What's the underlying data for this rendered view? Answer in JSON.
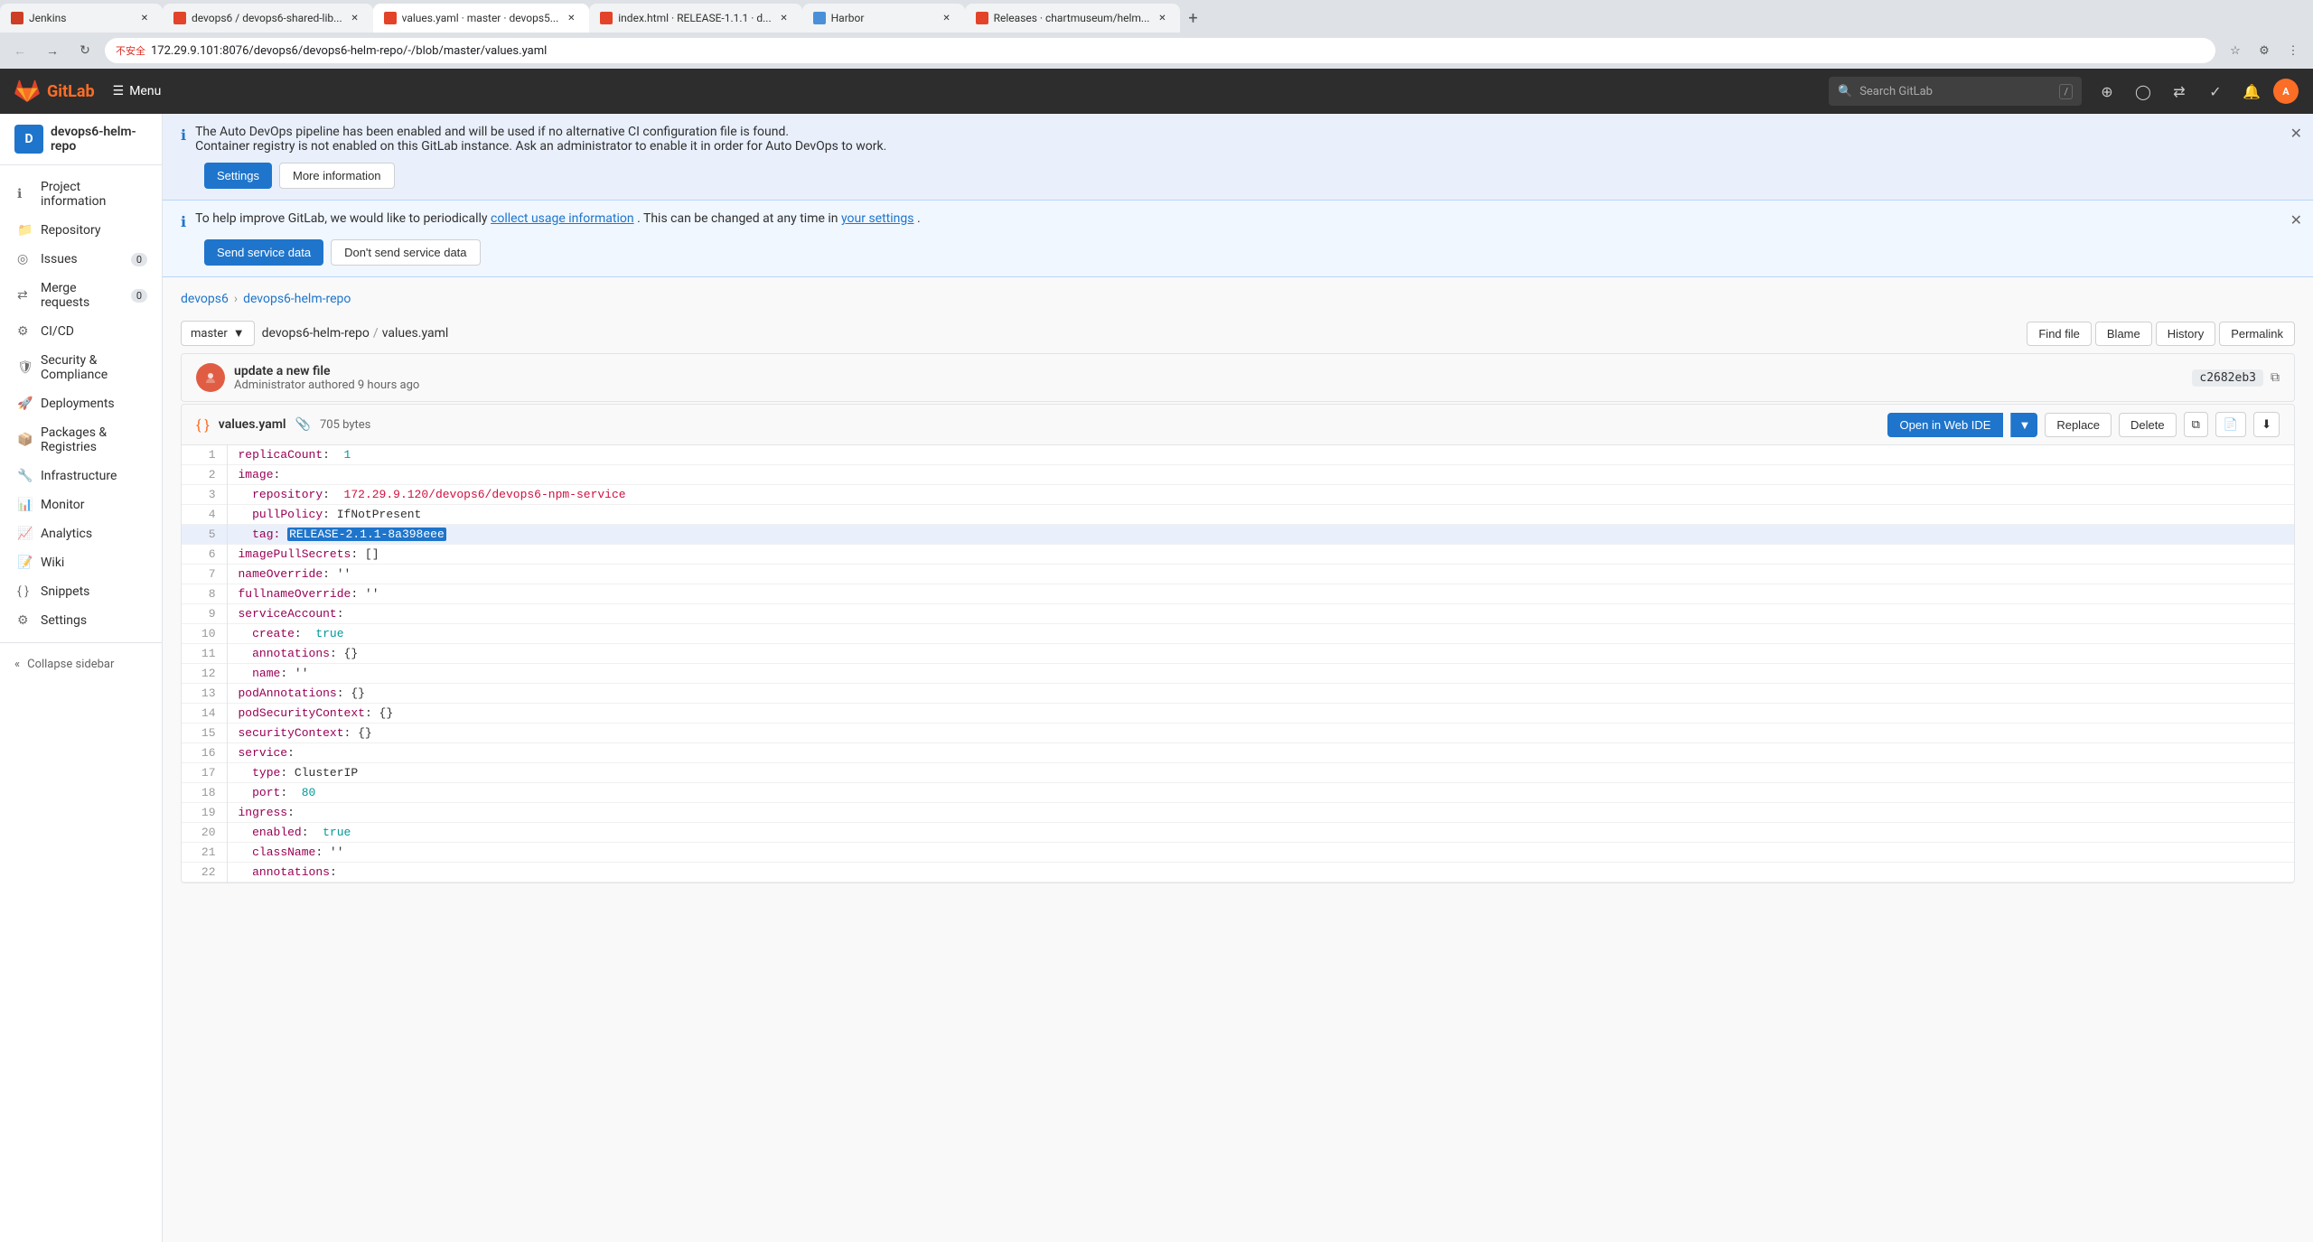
{
  "browser": {
    "tabs": [
      {
        "id": "jenkins",
        "title": "Jenkins",
        "favicon_color": "#cc3e26",
        "active": false
      },
      {
        "id": "devops6",
        "title": "devops6 / devops6-shared-lib...",
        "favicon_color": "#e24329",
        "active": false
      },
      {
        "id": "values-yaml",
        "title": "values.yaml · master · devops5...",
        "favicon_color": "#e24329",
        "active": true
      },
      {
        "id": "index-html",
        "title": "index.html · RELEASE-1.1.1 · d...",
        "favicon_color": "#e24329",
        "active": false
      },
      {
        "id": "harbor",
        "title": "Harbor",
        "favicon_color": "#4a90d9",
        "active": false
      },
      {
        "id": "releases",
        "title": "Releases · chartmuseum/helm...",
        "favicon_color": "#e24329",
        "active": false
      }
    ],
    "url": "172.29.9.101:8076/devops6/devops6-helm-repo/-/blob/master/values.yaml",
    "url_secure_label": "不安全"
  },
  "header": {
    "logo": "GitLab",
    "menu_label": "Menu",
    "search_placeholder": "Search GitLab",
    "search_shortcut": "/"
  },
  "sidebar": {
    "project_name": "devops6-helm-repo",
    "project_initial": "D",
    "items": [
      {
        "id": "project-information",
        "label": "Project information",
        "icon": "info"
      },
      {
        "id": "repository",
        "label": "Repository",
        "icon": "folder"
      },
      {
        "id": "issues",
        "label": "Issues",
        "icon": "issue",
        "badge": "0"
      },
      {
        "id": "merge-requests",
        "label": "Merge requests",
        "icon": "merge",
        "badge": "0"
      },
      {
        "id": "cicd",
        "label": "CI/CD",
        "icon": "cicd"
      },
      {
        "id": "security-compliance",
        "label": "Security & Compliance",
        "icon": "shield"
      },
      {
        "id": "deployments",
        "label": "Deployments",
        "icon": "deploy"
      },
      {
        "id": "packages-registries",
        "label": "Packages & Registries",
        "icon": "package"
      },
      {
        "id": "infrastructure",
        "label": "Infrastructure",
        "icon": "infra"
      },
      {
        "id": "monitor",
        "label": "Monitor",
        "icon": "monitor"
      },
      {
        "id": "analytics",
        "label": "Analytics",
        "icon": "chart"
      },
      {
        "id": "wiki",
        "label": "Wiki",
        "icon": "wiki"
      },
      {
        "id": "snippets",
        "label": "Snippets",
        "icon": "snippet"
      },
      {
        "id": "settings",
        "label": "Settings",
        "icon": "gear"
      }
    ],
    "collapse_label": "Collapse sidebar"
  },
  "banners": {
    "autodevops": {
      "text1": "The Auto DevOps pipeline has been enabled and will be used if no alternative CI configuration file is found.",
      "text2": "Container registry is not enabled on this GitLab instance. Ask an administrator to enable it in order for Auto DevOps to work.",
      "btn_settings": "Settings",
      "btn_more": "More information"
    },
    "usage": {
      "text_prefix": "To help improve GitLab, we would like to periodically",
      "link_text": "collect usage information",
      "text_middle": ". This can be changed at any time in",
      "link_settings": "your settings",
      "text_suffix": ".",
      "btn_send": "Send service data",
      "btn_dont_send": "Don't send service data"
    }
  },
  "breadcrumb": {
    "items": [
      "devops6",
      "devops6-helm-repo"
    ]
  },
  "file_toolbar": {
    "branch": "master",
    "repo": "devops6-helm-repo",
    "separator": "/",
    "filename": "values.yaml",
    "btn_find": "Find file",
    "btn_blame": "Blame",
    "btn_history": "History",
    "btn_permalink": "Permalink"
  },
  "commit": {
    "message": "update a new file",
    "author": "Administrator",
    "authored": "authored 9 hours ago",
    "hash": "c2682eb3"
  },
  "file": {
    "icon": "{}",
    "name": "values.yaml",
    "copy_icon": "📎",
    "size": "705 bytes",
    "btn_open_ide": "Open in Web IDE",
    "btn_replace": "Replace",
    "btn_delete": "Delete"
  },
  "code": {
    "lines": [
      {
        "num": 1,
        "content": "replicaCount: 1",
        "type": "normal"
      },
      {
        "num": 2,
        "content": "image:",
        "type": "normal"
      },
      {
        "num": 3,
        "content": "  repository: 172.29.9.120/devops6/devops6-npm-service",
        "type": "normal"
      },
      {
        "num": 4,
        "content": "  pullPolicy: IfNotPresent",
        "type": "normal"
      },
      {
        "num": 5,
        "content": "  tag: RELEASE-2.1.1-8a398eee",
        "type": "highlight"
      },
      {
        "num": 6,
        "content": "imagePullSecrets: []",
        "type": "normal"
      },
      {
        "num": 7,
        "content": "nameOverride: ''",
        "type": "normal"
      },
      {
        "num": 8,
        "content": "fullnameOverride: ''",
        "type": "normal"
      },
      {
        "num": 9,
        "content": "serviceAccount:",
        "type": "normal"
      },
      {
        "num": 10,
        "content": "  create: true",
        "type": "normal"
      },
      {
        "num": 11,
        "content": "  annotations: {}",
        "type": "normal"
      },
      {
        "num": 12,
        "content": "  name: ''",
        "type": "normal"
      },
      {
        "num": 13,
        "content": "podAnnotations: {}",
        "type": "normal"
      },
      {
        "num": 14,
        "content": "podSecurityContext: {}",
        "type": "normal"
      },
      {
        "num": 15,
        "content": "securityContext: {}",
        "type": "normal"
      },
      {
        "num": 16,
        "content": "service:",
        "type": "normal"
      },
      {
        "num": 17,
        "content": "  type: ClusterIP",
        "type": "normal"
      },
      {
        "num": 18,
        "content": "  port: 80",
        "type": "normal"
      },
      {
        "num": 19,
        "content": "ingress:",
        "type": "normal"
      },
      {
        "num": 20,
        "content": "  enabled: true",
        "type": "normal"
      },
      {
        "num": 21,
        "content": "  className: ''",
        "type": "normal"
      },
      {
        "num": 22,
        "content": "  annotations:",
        "type": "normal"
      }
    ]
  },
  "colors": {
    "primary": "#1f75cb",
    "gitlab_orange": "#fc6d26",
    "sidebar_bg": "#fff",
    "code_highlight": "#e9f0fb"
  }
}
